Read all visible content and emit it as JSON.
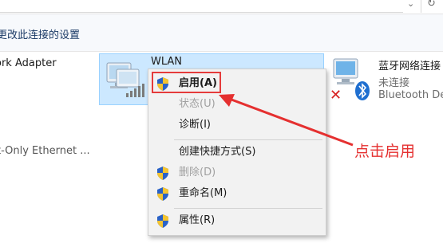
{
  "topbar": {
    "chevron_icon": "chevron-down-icon",
    "refresh_icon": "refresh-icon"
  },
  "command_bar": {
    "change_settings": "更改此连接的设置"
  },
  "adapters": [
    {
      "name": "ork Adapter",
      "status": ""
    },
    {
      "name": "WLAN",
      "status": ""
    },
    {
      "name": "蓝牙网络连接",
      "status": "未连接",
      "device": "Bluetooth De"
    },
    {
      "name": "t-Only Ethernet ...",
      "status": ""
    }
  ],
  "context_menu": {
    "items": [
      {
        "label": "启用(A)",
        "icon": "shield-icon",
        "disabled": false,
        "bold": true
      },
      {
        "label": "状态(U)",
        "icon": "",
        "disabled": true
      },
      {
        "label": "诊断(I)",
        "icon": "",
        "disabled": false
      },
      {
        "label": "创建快捷方式(S)",
        "icon": "",
        "disabled": false
      },
      {
        "label": "删除(D)",
        "icon": "shield-icon",
        "disabled": true
      },
      {
        "label": "重命名(M)",
        "icon": "shield-icon",
        "disabled": false
      },
      {
        "label": "属性(R)",
        "icon": "shield-icon",
        "disabled": false
      }
    ]
  },
  "annotation": {
    "text": "点击启用",
    "color": "#e53030"
  },
  "colors": {
    "selection_bg": "#cce8ff",
    "highlight_border": "#e53b3b",
    "menu_bg": "#f2f2f2"
  }
}
